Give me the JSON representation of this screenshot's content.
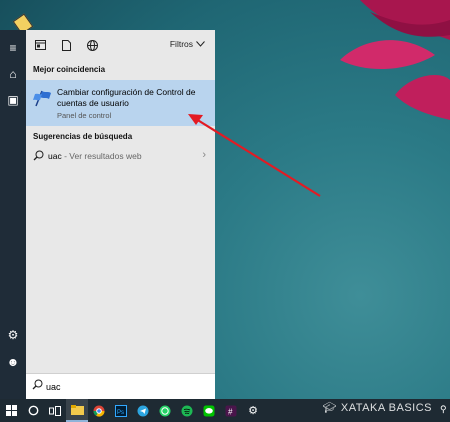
{
  "colors": {
    "accent_highlight": "#b9d4ee",
    "arrow": "#e31b23",
    "taskbar": "#1e2a33",
    "panel": "#e8e8e8"
  },
  "rail": {
    "items": [
      {
        "icon": "hamburger-menu-icon",
        "glyph": "≡"
      },
      {
        "icon": "home-icon",
        "glyph": "⌂"
      },
      {
        "icon": "notebook-icon",
        "glyph": "▣"
      },
      {
        "icon": "settings-icon",
        "glyph": "⚙"
      },
      {
        "icon": "feedback-icon",
        "glyph": "☻"
      }
    ]
  },
  "panel": {
    "filters_label": "Filtros",
    "best_match_label": "Mejor coincidencia",
    "best_match": {
      "title": "Cambiar configuración de Control de cuentas de usuario",
      "subtitle": "Panel de control"
    },
    "suggestions_label": "Sugerencias de búsqueda",
    "suggestion": {
      "query": "uac",
      "hint": " - Ver resultados web"
    }
  },
  "search": {
    "value": "uac"
  },
  "taskbar": {
    "watermark": "XATAKA BASICS"
  }
}
